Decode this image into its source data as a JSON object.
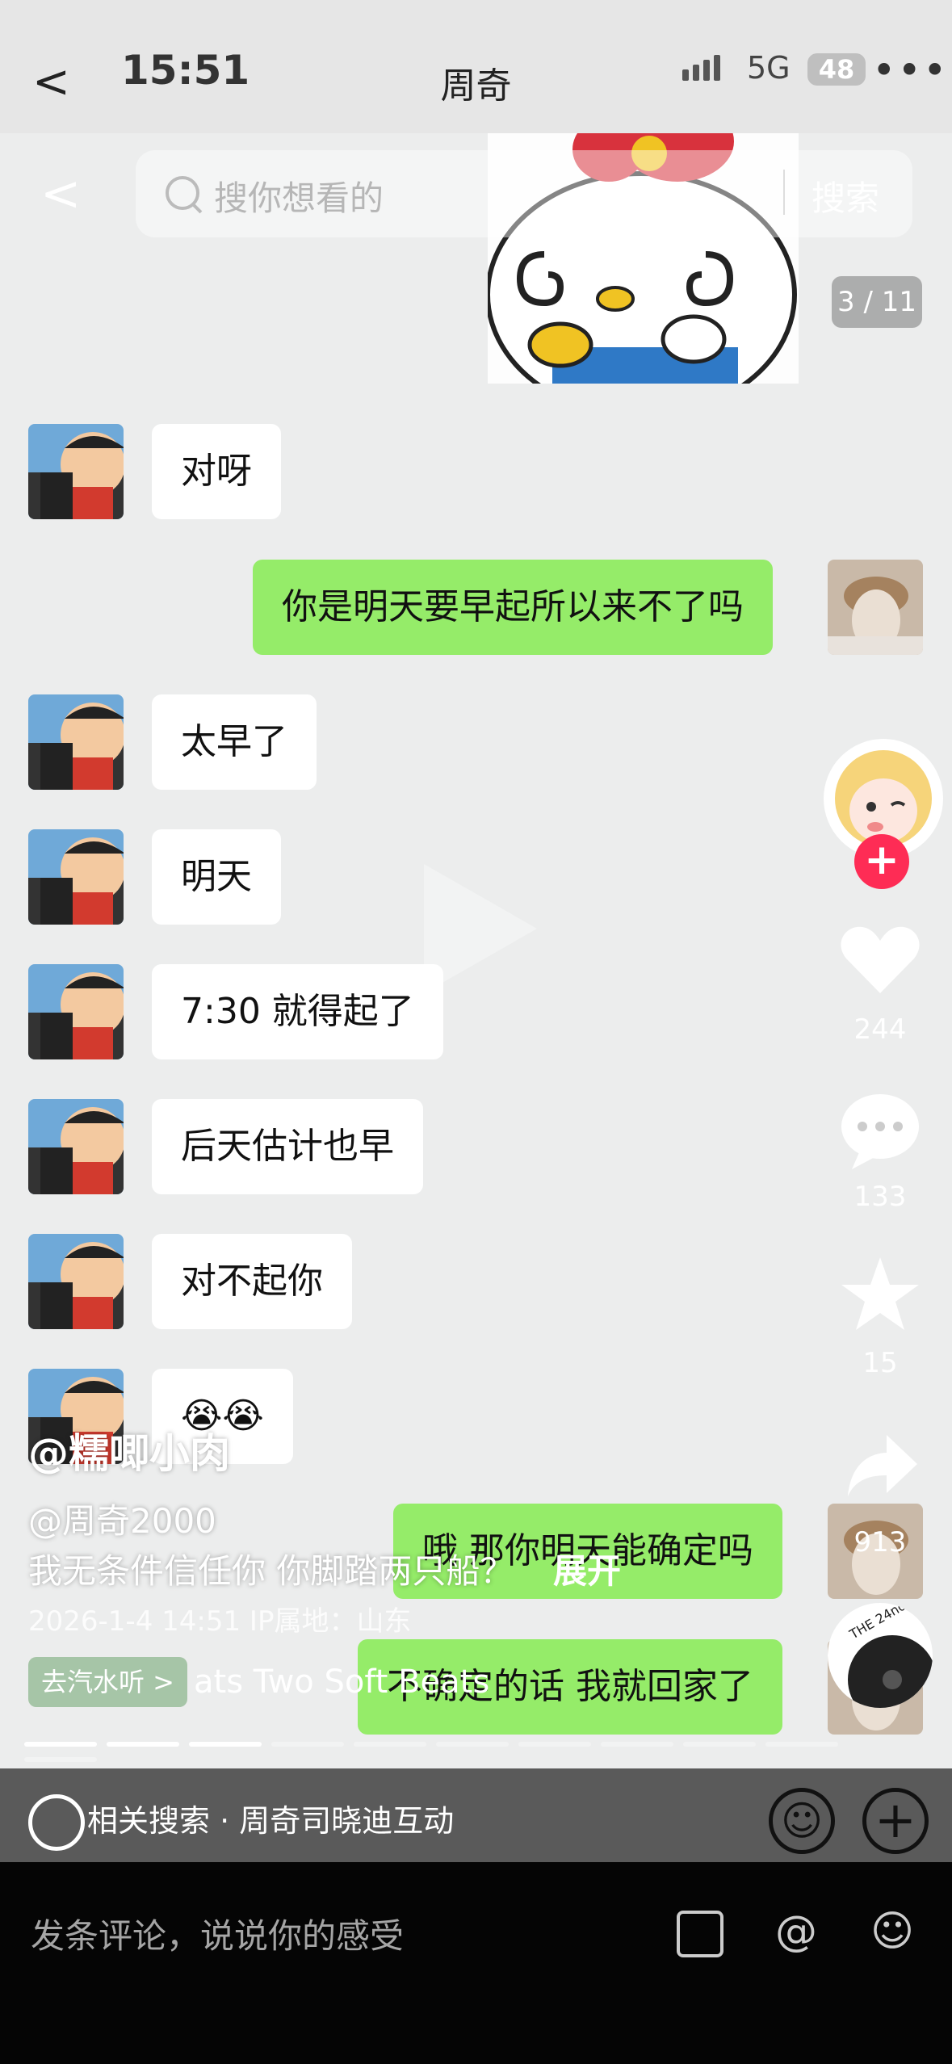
{
  "status": {
    "time": "15:51",
    "network": "5G",
    "battery": "48"
  },
  "header": {
    "title": "周奇",
    "back": "<"
  },
  "search": {
    "back": "<",
    "placeholder": "搜你想看的",
    "button": "搜索"
  },
  "image_counter": "3 / 11",
  "messages": [
    {
      "side": "left",
      "text": "对呀"
    },
    {
      "side": "right",
      "text": "你是明天要早起所以来不了吗"
    },
    {
      "side": "left",
      "text": "太早了"
    },
    {
      "side": "left",
      "text": "明天"
    },
    {
      "side": "left",
      "text": "7:30 就得起了"
    },
    {
      "side": "left",
      "text": "后天估计也早"
    },
    {
      "side": "left",
      "text": "对不起你"
    },
    {
      "side": "left",
      "text": "😭😭"
    },
    {
      "side": "right",
      "text": "哦 那你明天能确定吗"
    },
    {
      "side": "right",
      "text": "不确定的话 我就回家了"
    }
  ],
  "rail": {
    "follow": "+",
    "likes": "244",
    "comments": "133",
    "favorites": "15",
    "shares": "913"
  },
  "post": {
    "author": "@糯唧小肉",
    "mention": "@周奇2000",
    "description": "我无条件信任你 你脚踏两只船？",
    "expand": "展开",
    "meta": "2026-1-4 14:51   IP属地：山东",
    "music_tag": "去汽水听 >",
    "music_name": "ats    Two Soft Beats"
  },
  "related": {
    "text": "相关搜索 · 周奇司晓迪互动"
  },
  "comment": {
    "placeholder": "发条评论，说说你的感受"
  },
  "colors": {
    "bubble_right": "#95ec69",
    "follow": "#fe2c55",
    "bar": "#050505"
  }
}
